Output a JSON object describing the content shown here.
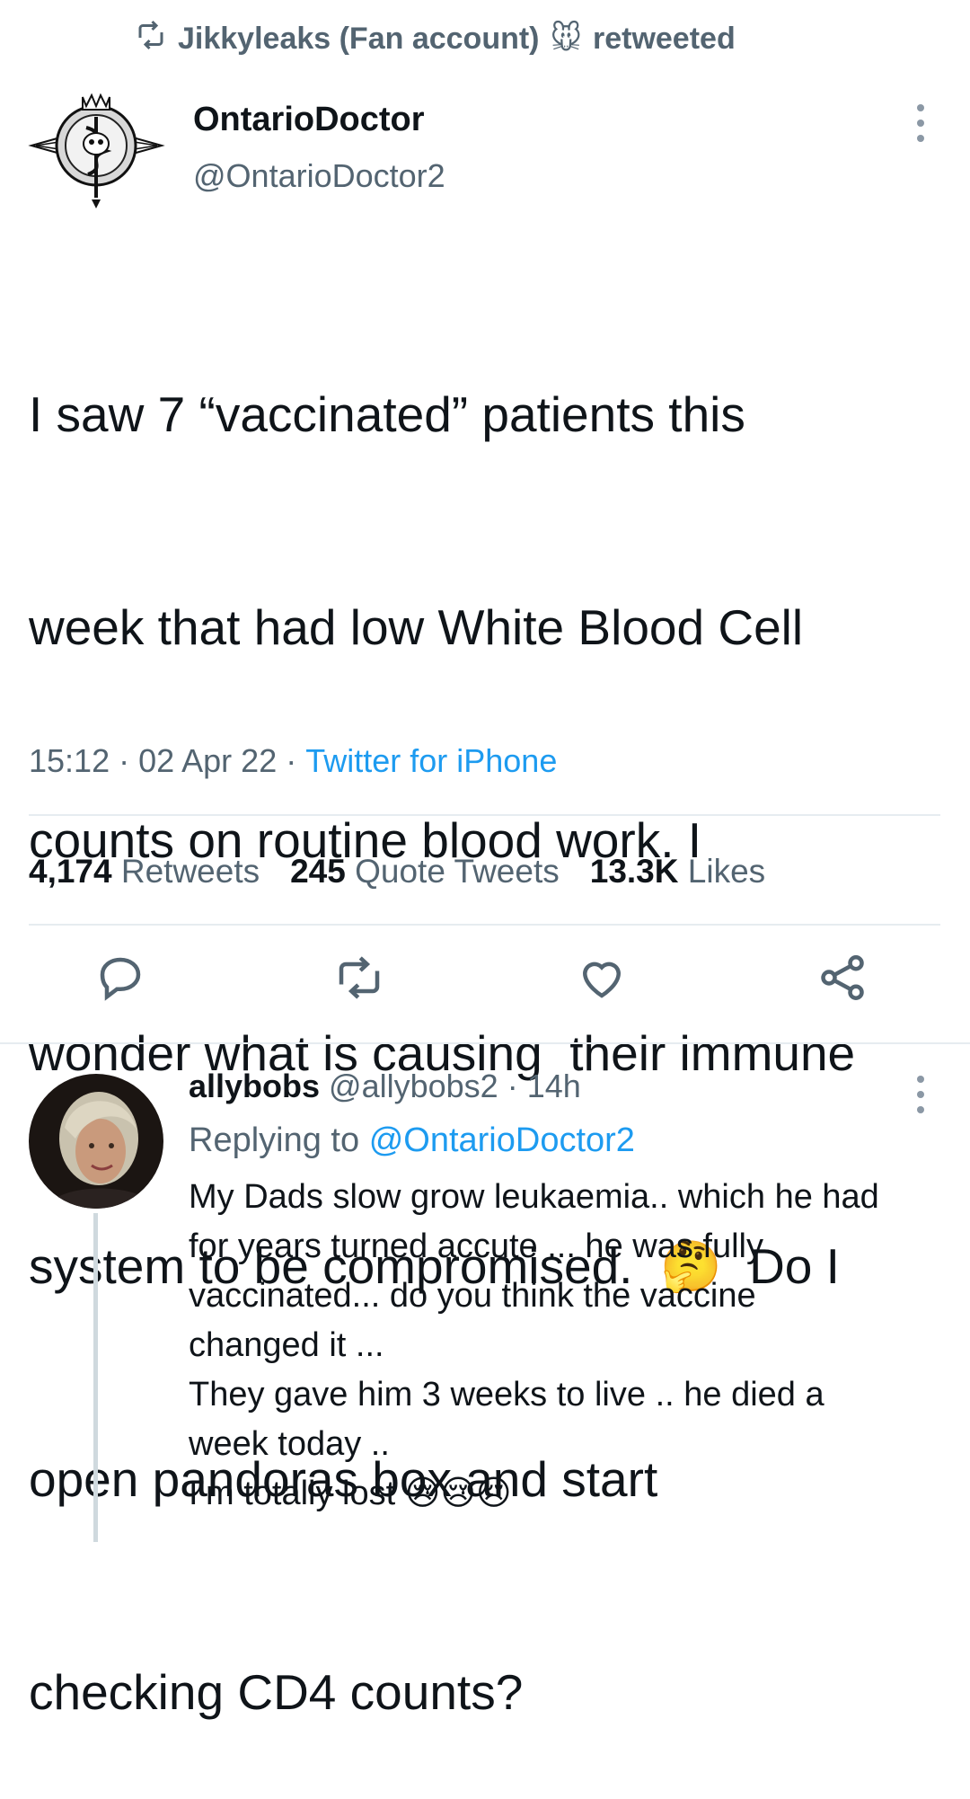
{
  "retweet_bar": {
    "retweeter": "Jikkyleaks (Fan account)",
    "emoji": "🐭",
    "suffix": "retweeted"
  },
  "tweet": {
    "author_name": "OntarioDoctor",
    "author_handle": "@OntarioDoctor2",
    "text_lines": [
      "I saw 7 “vaccinated” patients this",
      "week that had low White Blood Cell",
      "counts on routine blood work. I",
      "wonder what is causing  their immune",
      "system to be compromised.  🤔  Do I",
      "open pandoras box and start",
      "checking CD4 counts?"
    ],
    "time": "15:12",
    "date": "02 Apr 22",
    "separator": "·",
    "client": "Twitter for iPhone",
    "stats": {
      "retweets_count": "4,174",
      "retweets_label": "Retweets",
      "quotes_count": "245",
      "quotes_label": "Quote Tweets",
      "likes_count": "13.3K",
      "likes_label": "Likes"
    }
  },
  "reply": {
    "name": "allybobs",
    "handle": "@allybobs2",
    "separator": "·",
    "time": "14h",
    "replying_prefix": "Replying to",
    "replying_to": "@OntarioDoctor2",
    "text_lines": [
      "My Dads slow grow leukaemia.. which he had",
      "for years turned accute ... he was fully",
      "vaccinated... do you think the vaccine",
      "changed it ...",
      "They gave him 3 weeks to live .. he died a",
      "week today ..",
      "I’m totally lost 😢😢😢"
    ]
  },
  "colors": {
    "text": "#0f1419",
    "secondary": "#536471",
    "link": "#1d9bf0",
    "divider": "#e6ecf0"
  }
}
